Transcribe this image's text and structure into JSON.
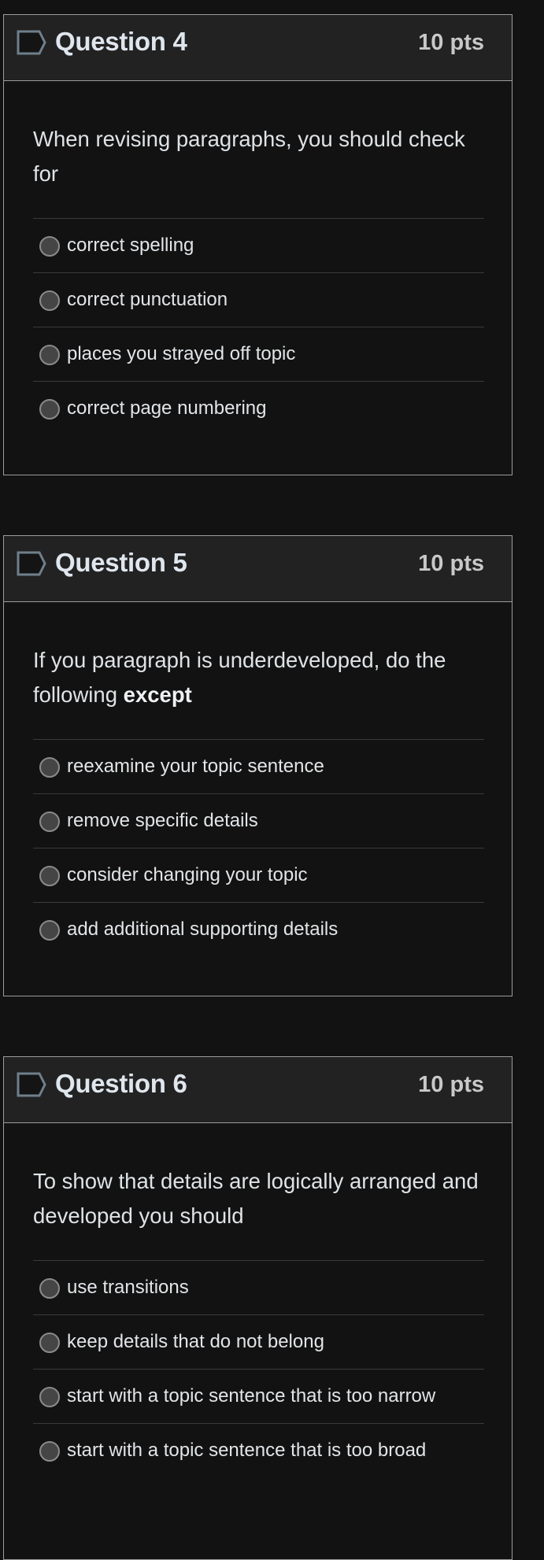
{
  "questions": [
    {
      "title": "Question 4",
      "points": "10 pts",
      "text": "When revising paragraphs, you should check for",
      "text_emphasis": "",
      "answers": [
        "correct spelling",
        "correct punctuation",
        "places you strayed off topic",
        "correct page numbering"
      ]
    },
    {
      "title": "Question 5",
      "points": "10 pts",
      "text": "If you paragraph is underdeveloped, do the following ",
      "text_emphasis": "except",
      "answers": [
        "reexamine your topic sentence",
        "remove specific details",
        "consider changing your topic",
        "add additional supporting details"
      ]
    },
    {
      "title": "Question 6",
      "points": "10 pts",
      "text": "To show that details are logically arranged and developed you should",
      "text_emphasis": "",
      "answers": [
        "use transitions",
        "keep details that do not belong",
        "start with a topic sentence that is too narrow",
        "start with a topic sentence that is too broad"
      ]
    }
  ],
  "icons": {
    "flag": "flag-question-icon",
    "radio": "radio-unselected"
  },
  "colors": {
    "page_bg": "#121212",
    "header_bg": "#222222",
    "border": "#9c9c9c",
    "radio_fill": "#454545"
  }
}
